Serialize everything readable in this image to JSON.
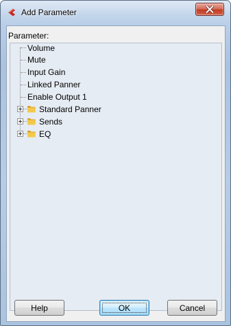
{
  "window": {
    "title": "Add Parameter",
    "icons": {
      "app": "cubase-app-icon",
      "close": "close-icon"
    }
  },
  "parameter_label": "Parameter:",
  "tree": {
    "items": [
      {
        "label": "Volume",
        "type": "leaf"
      },
      {
        "label": "Mute",
        "type": "leaf"
      },
      {
        "label": "Input Gain",
        "type": "leaf"
      },
      {
        "label": "Linked Panner",
        "type": "leaf"
      },
      {
        "label": "Enable Output 1",
        "type": "leaf"
      },
      {
        "label": "Standard Panner",
        "type": "folder",
        "expanded": false,
        "icon": "folder-icon"
      },
      {
        "label": "Sends",
        "type": "folder",
        "expanded": false,
        "icon": "folder-icon"
      },
      {
        "label": "EQ",
        "type": "folder",
        "expanded": false,
        "icon": "folder-icon"
      }
    ]
  },
  "buttons": {
    "help": "Help",
    "ok": "OK",
    "cancel": "Cancel"
  },
  "colors": {
    "close_button": "#c23c22",
    "folder": "#e8b93a",
    "tree_background": "#e6ecf3",
    "dialog_background": "#f0f0f0",
    "default_button": "#bee6fd"
  }
}
